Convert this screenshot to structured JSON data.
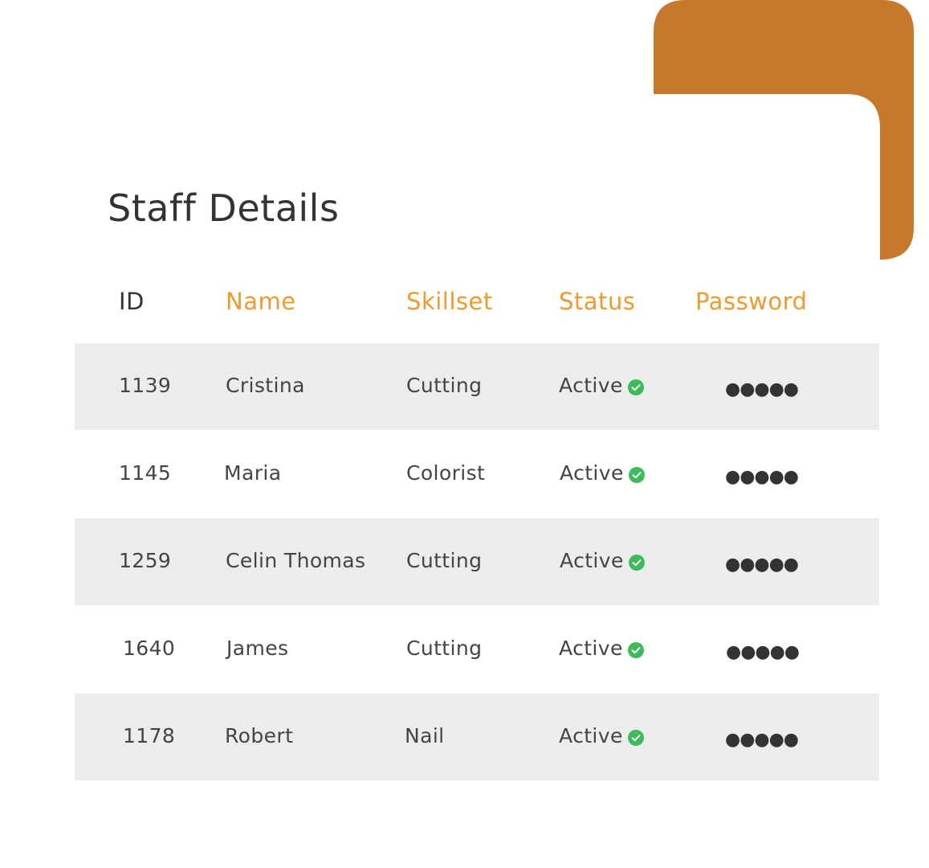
{
  "page": {
    "title": "Staff Details"
  },
  "colors": {
    "accent": "#ef9a2e",
    "bracket": "#c8782a",
    "stripe": "#ececec",
    "status_ok": "#3dbb5b",
    "text": "#444444"
  },
  "table": {
    "headers": {
      "id": "ID",
      "name": "Name",
      "skillset": "Skillset",
      "status": "Status",
      "password": "Password"
    },
    "rows": [
      {
        "id": "1139",
        "name": "Cristina",
        "skillset": "Cutting",
        "status": "Active",
        "password": "●●●●●",
        "status_icon": "check-circle-icon"
      },
      {
        "id": "1145",
        "name": "Maria",
        "skillset": "Colorist",
        "status": "Active",
        "password": "●●●●●",
        "status_icon": "check-circle-icon"
      },
      {
        "id": "1259",
        "name": "Celin Thomas",
        "skillset": "Cutting",
        "status": "Active",
        "password": "●●●●●",
        "status_icon": "check-circle-icon"
      },
      {
        "id": "1640",
        "name": "James",
        "skillset": "Cutting",
        "status": "Active",
        "password": "●●●●●",
        "status_icon": "check-circle-icon"
      },
      {
        "id": "1178",
        "name": "Robert",
        "skillset": "Nail",
        "status": "Active",
        "password": "●●●●●",
        "status_icon": "check-circle-icon"
      }
    ]
  }
}
